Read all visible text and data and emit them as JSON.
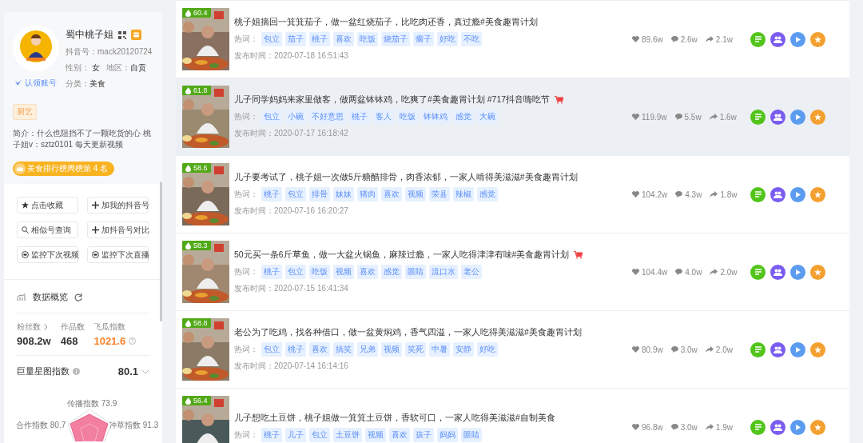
{
  "profile": {
    "name": "蜀中桃子姐",
    "douyin_id": "抖音号：mack20120724",
    "gender_label": "性别：",
    "gender": "女",
    "region_label": "地区：",
    "region": "自贡",
    "category_label": "分类：",
    "category": "美食",
    "claim": "认领账号",
    "tag": "厨艺",
    "bio": "简介：什么也阻挡不了一颗吃货的心 桃子姐v：sztz0101 每天更新视频",
    "rank_badge": "美食排行榜周榜第 4 名"
  },
  "actions": [
    {
      "kind": "star",
      "label": "点击收藏"
    },
    {
      "kind": "plus",
      "label": "加我的抖音号"
    },
    {
      "kind": "search",
      "label": "相似号查询"
    },
    {
      "kind": "plus",
      "label": "加抖音号对比"
    },
    {
      "kind": "eye",
      "label": "监控下次视频"
    },
    {
      "kind": "eye",
      "label": "监控下次直播"
    }
  ],
  "overview": {
    "title": "数据概览",
    "stats": [
      {
        "label": "粉丝数",
        "value": "908.2w",
        "kind": "link"
      },
      {
        "label": "作品数",
        "value": "468",
        "kind": "plain"
      },
      {
        "label": "飞瓜指数",
        "value": "1021.6",
        "kind": "highlight"
      }
    ],
    "star_index_label": "巨量星图指数",
    "star_index": "80.1",
    "radar_labels": [
      "传播指数 73.9",
      "合作指数 80.7",
      "种草指数 91.3"
    ]
  },
  "videos": [
    {
      "score": "60.4",
      "title": "桃子姐摘回一箕箕茄子，做一盆红烧茄子，比吃肉还香，真过瘾#美食趣胃计划",
      "cart": false,
      "highlighted": false,
      "hot_label": "热词：",
      "tags": [
        "包立",
        "茄子",
        "桃子",
        "喜欢",
        "吃饭",
        "烧茄子",
        "瘸子",
        "好吃",
        "不吃"
      ],
      "date": "发布时间：2020-07-18 16:51:43",
      "likes": "89.6w",
      "comments": "2.6w",
      "shares": "2.1w"
    },
    {
      "score": "61.8",
      "title": "儿子同学妈妈来家里做客，做两盆钵钵鸡，吃爽了#美食趣胃计划 #717抖音嗨吃节",
      "cart": true,
      "highlighted": true,
      "hot_label": "热词：",
      "tags": [
        "包立",
        "小碗",
        "不好意思",
        "桃子",
        "客人",
        "吃饭",
        "钵钵鸡",
        "感觉",
        "大碗"
      ],
      "date": "发布时间：2020-07-17 16:18:42",
      "likes": "119.9w",
      "comments": "5.5w",
      "shares": "1.6w"
    },
    {
      "score": "58.6",
      "title": "儿子要考试了，桃子姐一次做5斤糖醋排骨，肉香浓郁，一家人啃得美滋滋#美食趣胃计划",
      "cart": false,
      "highlighted": false,
      "hot_label": "热词：",
      "tags": [
        "桃子",
        "包立",
        "排骨",
        "妹妹",
        "猪肉",
        "喜欢",
        "视频",
        "荣县",
        "辣椒",
        "感觉"
      ],
      "date": "发布时间：2020-07-16 16:20:27",
      "likes": "104.2w",
      "comments": "4.3w",
      "shares": "1.8w"
    },
    {
      "score": "58.3",
      "title": "50元买一条6斤草鱼，做一大盆火锅鱼，麻辣过瘾，一家人吃得津津有味#美食趣胃计划",
      "cart": true,
      "highlighted": false,
      "hot_label": "热词：",
      "tags": [
        "桃子",
        "包立",
        "吃饭",
        "视频",
        "喜欢",
        "感觉",
        "眼睛",
        "流口水",
        "老公"
      ],
      "date": "发布时间：2020-07-15 16:41:34",
      "likes": "104.4w",
      "comments": "4.0w",
      "shares": "2.0w"
    },
    {
      "score": "58.8",
      "title": "老公为了吃鸡，找各种借口，做一盆黄焖鸡，香气四溢，一家人吃得美滋滋#美食趣胃计划",
      "cart": false,
      "highlighted": false,
      "hot_label": "热词：",
      "tags": [
        "包立",
        "桃子",
        "喜欢",
        "搞笑",
        "兄弟",
        "视频",
        "笑死",
        "中暑",
        "安静",
        "好吃"
      ],
      "date": "发布时间：2020-07-14 16:14:16",
      "likes": "80.9w",
      "comments": "3.0w",
      "shares": "2.0w"
    },
    {
      "score": "56.4",
      "title": "儿子想吃土豆饼，桃子姐做一箕箕土豆饼，香软可口，一家人吃得美滋滋#自制美食",
      "cart": false,
      "highlighted": false,
      "hot_label": "热词：",
      "tags": [
        "桃子",
        "儿子",
        "包立",
        "土豆饼",
        "视频",
        "喜欢",
        "孩子",
        "妈妈",
        "眼睛"
      ],
      "likes": "96.8w",
      "comments": "3.0w",
      "shares": "1.9w"
    }
  ]
}
